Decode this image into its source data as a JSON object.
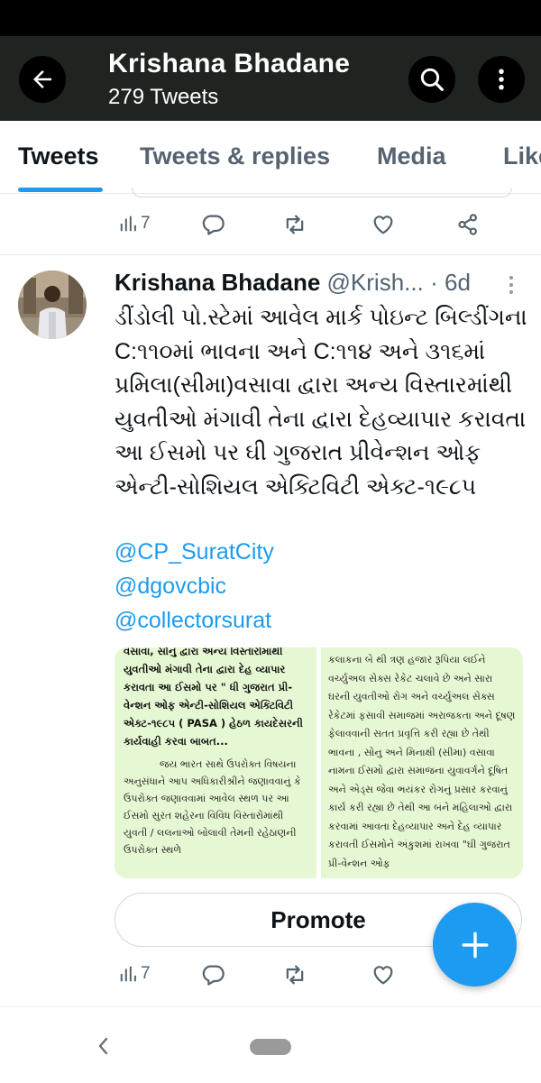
{
  "header": {
    "title": "Krishana Bhadane",
    "subtitle": "279 Tweets",
    "back_icon": "arrow-left-icon",
    "search_icon": "search-icon",
    "more_icon": "more-vertical-icon",
    "bar_color": "#1f2421"
  },
  "tabs": [
    {
      "label": "Tweets",
      "active": true
    },
    {
      "label": "Tweets & replies",
      "active": false
    },
    {
      "label": "Media",
      "active": false
    },
    {
      "label": "Likes",
      "active": false
    }
  ],
  "accent_color": "#1d9bf0",
  "prev_tweet": {
    "views": "7"
  },
  "tweet": {
    "author": "Krishana Bhadane",
    "handle": "@Krish...",
    "separator": "·",
    "time": "6d",
    "text": "ડીંડોલી પો.સ્ટેમાં આવેલ માર્ક પોઇન્ટ બિલ્ડીંગના C:૧૧૦માં ભાવના અને C:૧૧૪ અને ૩૧૬માં પ્રમિલા(સીમા)વસાવા દ્વારા અન્ય વિસ્તારમાંથી યુવતીઓ મંગાવી તેના દ્વારા દેહવ્યાપાર કરાવતા આ ઈસમો પર ઘી ગુજરાત પ્રીવેન્શન ઓફ એન્ટી-સોશિયલ એક્ટિવિટી એક્ટ-૧૯૮૫",
    "mentions": [
      "@CP_SuratCity",
      "@dgovcbic",
      "@collectorsurat"
    ],
    "image_left": {
      "bold_text": "વસાવા, સોનુ દ્વારા અન્ય વિસ્તારોમાંથી યુવતીઓ મંગાવી તેના દ્વારા દેહ વ્યાપાર કરાવતા આ ઈસમો પર \" ધી ગુજરાત પ્રી-વેન્શન ઓફ એન્ટી-સોશિયલ એક્ટિવિટી એક્ટ-૧૯૮૫ ( PASA ) હેઠળ કાયદેસરની કાર્યવાહી કરવા બાબત...",
      "body_text": "જય ભારત સાથે ઉપરોક્ત વિષયના અનુસંધાને આપ અધિકારીશ્રીને જણાવવાનું કે ઉપરોક્ત જણાવવામાં આવેલ સ્થળ પર આ ઈસમો સુરત શહેરના વિવિધ વિસ્તારોમાંથી યુવતી / લલનાઓ બોલાવી તેમની રહેઠાણની ઉપરોક્ત સ્થળે"
    },
    "image_right": {
      "body_text": "કલાકના બે થી ત્રણ હજાર રૂપિયા લઈને વર્ચ્યુઅલ સેક્સ રેકેટ ચલાવે છે અને સારા ઘરની યુવતીઓ રોગ અને વર્ચ્યુઅલ સેક્સ રેકેટમાં ફસાવી સમાજમાં અરાજકતા અને દૂષણ ફેલાવવાની સતત પ્રવૃત્તિ કરી રહ્યા છે તેથી ભાવના , સોનુ અને મિનાક્ષી (સીમા) વસાવા નામના ઈસમો દ્વારા સમાજના યુવાવર્ગને દૂષિત અને એડ્સ જેવા ભયંકર રોગનું પ્રસાર કરવાનું કાર્ય કરી રહ્યા છે તેથી આ બંને મહિલાઓ દ્વારા કરવામાં આવતા દેહવ્યાપાર અને દેહ વ્યાપાર કરાવતી ઈસમોને અંકુશમાં રાખવા \"ઘી ગુજરાત પ્રી-વેન્શન ઓફ"
    },
    "promote_label": "Promote",
    "views": "7"
  },
  "fab_icon": "plus-icon",
  "nav": {
    "back_icon": "chevron-left-icon",
    "home_icon": "home-pill-icon"
  }
}
